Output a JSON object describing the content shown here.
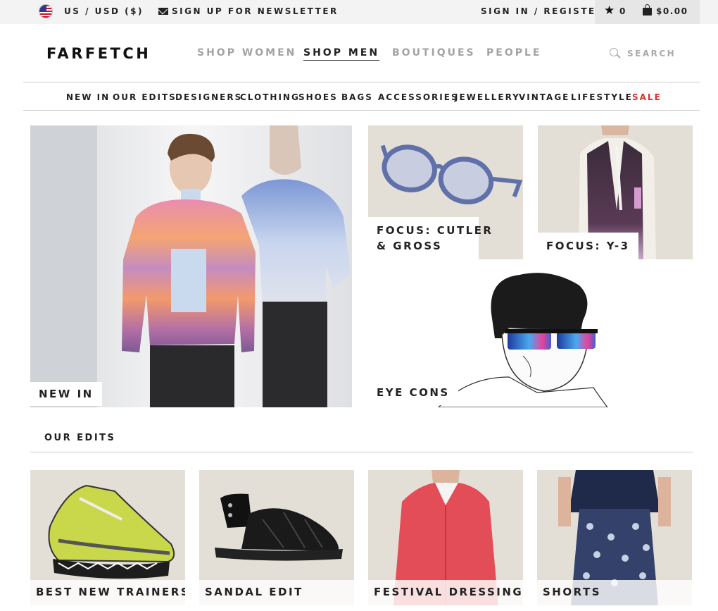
{
  "topbar": {
    "currency": "US / USD ($)",
    "newsletter": "SIGN UP FOR NEWSLETTER",
    "signin": "SIGN IN / REGISTER",
    "wishlist_count": "0",
    "cart_total": "$0.00"
  },
  "header": {
    "logo": "FARFETCH",
    "nav": [
      "SHOP WOMEN",
      "SHOP MEN",
      "BOUTIQUES",
      "PEOPLE"
    ],
    "active_nav": "SHOP MEN",
    "search_label": "SEARCH"
  },
  "subnav": [
    "NEW IN",
    "OUR EDITS",
    "DESIGNERS",
    "CLOTHING",
    "SHOES",
    "BAGS",
    "ACCESSORIES",
    "JEWELLERY",
    "VINTAGE",
    "LIFESTYLE",
    "SALE"
  ],
  "hero": {
    "new_in": "NEW IN",
    "focus_cutler_1": "FOCUS: CUTLER",
    "focus_cutler_2": "& GROSS",
    "focus_y3": "FOCUS: Y-3",
    "eye_cons": "EYE CONS"
  },
  "edits": {
    "title": "OUR EDITS",
    "items": [
      "BEST NEW TRAINERS",
      "SANDAL EDIT",
      "FESTIVAL DRESSING",
      "SHORTS"
    ]
  },
  "colors": {
    "sale": "#d0342c",
    "topbar_bg": "#f3f3f3",
    "nav_inactive": "#a3a3a3"
  }
}
